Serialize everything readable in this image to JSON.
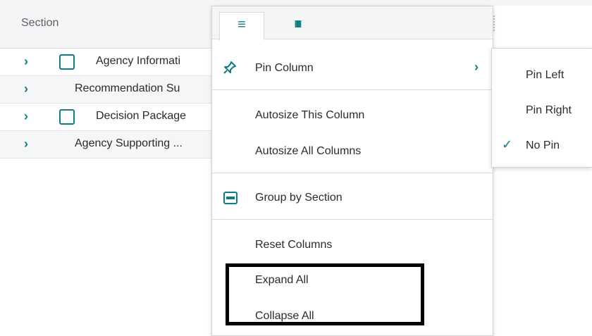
{
  "grid": {
    "header": {
      "column_label": "Section"
    },
    "rows": [
      {
        "label": "Agency Informati",
        "has_checkbox": true
      },
      {
        "label": "Recommendation Su",
        "has_checkbox": false
      },
      {
        "label": "Decision Package",
        "has_checkbox": true
      },
      {
        "label": "Agency Supporting ...",
        "has_checkbox": false
      }
    ],
    "expand_icon": "chevron-right-icon"
  },
  "menu": {
    "tabs": [
      {
        "name": "general-menu-tab",
        "icon": "hamburger-menu-icon",
        "glyph": "≡",
        "active": true
      },
      {
        "name": "columns-tab",
        "icon": "columns-icon",
        "glyph": "IIII",
        "active": false
      }
    ],
    "items": {
      "pin_column": {
        "label": "Pin Column",
        "icon": "pin-icon",
        "arrow": "›"
      },
      "autosize_this": {
        "label": "Autosize This Column"
      },
      "autosize_all": {
        "label": "Autosize All Columns"
      },
      "group_by": {
        "label": "Group by Section",
        "icon": "group-icon"
      },
      "reset": {
        "label": "Reset Columns"
      },
      "expand_all": {
        "label": "Expand All"
      },
      "collapse_all": {
        "label": "Collapse All"
      }
    }
  },
  "submenu": {
    "items": [
      {
        "label": "Pin Left",
        "checked": false
      },
      {
        "label": "Pin Right",
        "checked": false
      },
      {
        "label": "No Pin",
        "checked": true
      }
    ],
    "check_glyph": "✓"
  },
  "colors": {
    "accent": "#0f7d83",
    "header_bg": "#f4f5f6",
    "highlight_border": "#000000"
  }
}
